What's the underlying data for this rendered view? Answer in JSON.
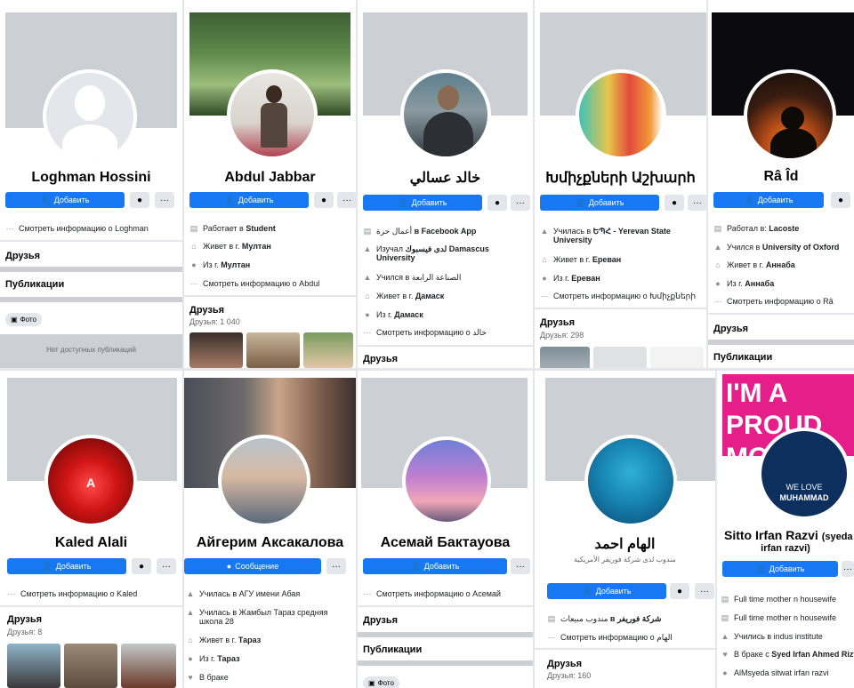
{
  "labels": {
    "add": "Добавить",
    "message": "Сообщение",
    "friends": "Друзья",
    "publications": "Публикации",
    "photo": "Фото",
    "no_posts": "Нет доступных публикаций",
    "dots": "···"
  },
  "icons": {
    "add_user": "add-user-icon",
    "messenger": "messenger-icon",
    "more": "more-icon",
    "work": "briefcase-icon",
    "home": "home-icon",
    "location": "location-pin-icon",
    "education": "graduation-cap-icon",
    "heart": "heart-icon"
  },
  "colors": {
    "primary": "#1877f2",
    "cover_gray": "#ccd0d5",
    "secondary_button": "#e4e6eb"
  },
  "profiles": [
    {
      "name": "Loghman Hossini",
      "info": [
        {
          "text": "Смотреть информацию о Loghman"
        }
      ],
      "friends": "Друзья",
      "publications": "Публикации"
    },
    {
      "name": "Abdul Jabbar",
      "info": [
        {
          "pre": "Работает в ",
          "bold": "Student"
        },
        {
          "pre": "Живет в г. ",
          "bold": "Мултан"
        },
        {
          "pre": "Из г. ",
          "bold": "Мултан"
        },
        {
          "text": "Смотреть информацию о Abdul"
        }
      ],
      "friends_count": "Друзья: 1 040"
    },
    {
      "name": "خالد عسالي",
      "info": [
        {
          "pre": "أعمال حرة ",
          "bold": "в Facebook App"
        },
        {
          "pre": "Изучал ",
          "bold": "لدى فيسبوك Damascus University"
        },
        {
          "pre": "Учился в ",
          "bold": "الصناعة الرابعة"
        },
        {
          "pre": "Живет в г. ",
          "bold": "Дамаск"
        },
        {
          "pre": "Из г. ",
          "bold": "Дамаск"
        },
        {
          "text": "Смотреть информацию о خالد"
        }
      ]
    },
    {
      "name": "Խմիչքների Աշխարհ",
      "info": [
        {
          "pre": "Училась в ",
          "bold": "ԵՊՀ - Yerevan State University"
        },
        {
          "pre": "Живет в г. ",
          "bold": "Ереван"
        },
        {
          "pre": "Из г. ",
          "bold": "Ереван"
        },
        {
          "text": "Смотреть информацию о Խմիչքների"
        }
      ],
      "friends_count": "Друзья: 298"
    },
    {
      "name": "Râ Îd",
      "info": [
        {
          "pre": "Работал в: ",
          "bold": "Lacoste"
        },
        {
          "pre": "Учился в ",
          "bold": "University of Oxford"
        },
        {
          "pre": "Живет в г. ",
          "bold": "Аннаба"
        },
        {
          "pre": "Из г. ",
          "bold": "Аннаба"
        },
        {
          "text": "Смотреть информацию о Râ"
        }
      ]
    },
    {
      "name": "Kaled Alali",
      "avatar_letter": "A",
      "info": [
        {
          "text": "Смотреть информацию о Kaled"
        }
      ],
      "friends_count": "Друзья: 8"
    },
    {
      "name": "Айгерим Аксакалова",
      "info": [
        {
          "text": "Училась в АГУ имени Абая"
        },
        {
          "text": "Училась в Жамбыл Тараз средняя школа 28"
        },
        {
          "pre": "Живет в г. ",
          "bold": "Тараз"
        },
        {
          "pre": "Из г. ",
          "bold": "Тараз"
        },
        {
          "text": "В браке"
        }
      ]
    },
    {
      "name": "Асемай Бактауова",
      "info": [
        {
          "text": "Смотреть информацию о Асемай"
        }
      ]
    },
    {
      "name": "الهام احمد",
      "subtitle": "مندوب لدى شركة فوريفر الأمريكية",
      "info": [
        {
          "pre": "مندوب مبيعات ",
          "bold": "в شركة فوريفر"
        },
        {
          "text": "Смотреть информацию о الهام"
        }
      ],
      "friends_count": "Друзья: 160"
    },
    {
      "name": "Sitto Irfan Razvi",
      "name_suffix": "(syeda",
      "name_line2": "irfan razvi)",
      "cover_text": "I'M A PROUD MO",
      "avatar_text_1": "WE LOVE",
      "avatar_text_2": "MUHAMMAD",
      "info": [
        {
          "text": "Full time mother n housewife"
        },
        {
          "text": "Full time mother n housewife"
        },
        {
          "text": "Учились в indus institute"
        },
        {
          "pre": "В браке с ",
          "bold": "Syed Irfan Ahmed Rizvi"
        },
        {
          "text": "AlMsyeda sitwat irfan razvi"
        }
      ]
    }
  ]
}
